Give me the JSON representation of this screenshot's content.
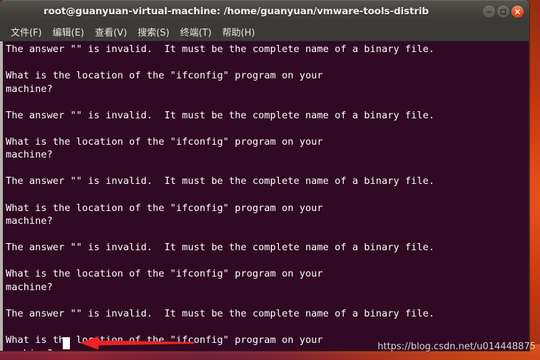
{
  "window": {
    "title": "root@guanyuan-virtual-machine: /home/guanyuan/vmware-tools-distrib",
    "controls": {
      "minimize": "minimize",
      "maximize": "maximize",
      "close": "close"
    }
  },
  "menubar": {
    "items": [
      {
        "label": "文件(F)"
      },
      {
        "label": "编辑(E)"
      },
      {
        "label": "查看(V)"
      },
      {
        "label": "搜索(S)"
      },
      {
        "label": "终端(T)"
      },
      {
        "label": "帮助(H)"
      }
    ]
  },
  "terminal": {
    "background_color": "#300a24",
    "text_color": "#ffffff",
    "lines": [
      "The answer \"\" is invalid.  It must be the complete name of a binary file.",
      "",
      "What is the location of the \"ifconfig\" program on your",
      "machine?",
      "",
      "The answer \"\" is invalid.  It must be the complete name of a binary file.",
      "",
      "What is the location of the \"ifconfig\" program on your",
      "machine?",
      "",
      "The answer \"\" is invalid.  It must be the complete name of a binary file.",
      "",
      "What is the location of the \"ifconfig\" program on your",
      "machine?",
      "",
      "The answer \"\" is invalid.  It must be the complete name of a binary file.",
      "",
      "What is the location of the \"ifconfig\" program on your",
      "machine?",
      "",
      "The answer \"\" is invalid.  It must be the complete name of a binary file.",
      "",
      "What is the location of the \"ifconfig\" program on your",
      "machine?"
    ],
    "cursor": {
      "shape": "block",
      "state": "active"
    }
  },
  "annotation": {
    "arrow_color": "#ee2222",
    "arrow_direction": "left",
    "target": "terminal-cursor"
  },
  "watermark": {
    "text": "https://blog.csdn.net/u014448875"
  },
  "colors": {
    "titlebar": "#46443f",
    "menubar": "#3c3a36",
    "terminal_bg": "#300a24",
    "close_button": "#e2532a",
    "desktop_accent": "#d2461a"
  }
}
